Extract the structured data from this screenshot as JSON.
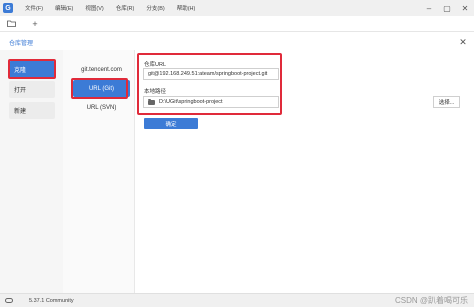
{
  "app": {
    "icon_letter": "G"
  },
  "menu": [
    "文件(F)",
    "编辑(E)",
    "视图(V)",
    "仓库(R)",
    "分支(B)",
    "帮助(H)"
  ],
  "window_controls": {
    "minimize": "–",
    "maximize": "▢",
    "close": "✕"
  },
  "toolbar": {
    "folder_icon": "folder-icon",
    "add_icon": "+"
  },
  "dialog": {
    "title": "仓库管理",
    "close": "✕"
  },
  "left_nav": {
    "clone": "克隆",
    "open": "打开",
    "new": "新建"
  },
  "sources": {
    "tencent": "git.tencent.com",
    "url_git": "URL (Git)",
    "url_svn": "URL (SVN)"
  },
  "form": {
    "repo_url_label": "仓库URL",
    "repo_url_value": "git@192.168.249.51:ateam/springboot-project.git",
    "local_path_label": "本地路径",
    "local_path_value": "D:\\UGit\\springboot-project",
    "select_button": "选择...",
    "confirm_button": "确定"
  },
  "status": {
    "version": "5.37.1 Community",
    "watermark": "CSDN @趴着喝可乐"
  },
  "colors": {
    "accent": "#3c7bd6",
    "highlight": "#e02a3a"
  }
}
